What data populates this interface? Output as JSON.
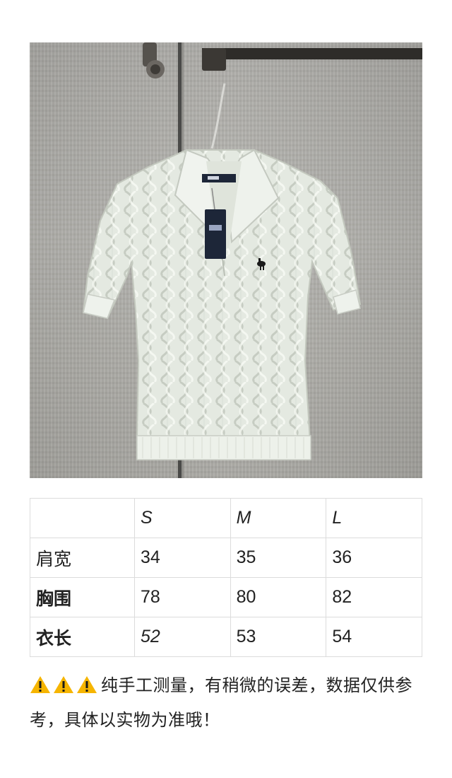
{
  "photo": {
    "icon": "cable-knit-polo-shirt-photo",
    "colors": {
      "wall": "#aeada8",
      "shirt": "#e6ebe3",
      "shirt_shadow": "#c9cec4",
      "tag": "#1d2638"
    }
  },
  "size_table": {
    "headers": [
      "",
      "S",
      "M",
      "L"
    ],
    "rows": [
      {
        "label": "肩宽",
        "values": [
          "34",
          "35",
          "36"
        ]
      },
      {
        "label": "胸围",
        "values": [
          "78",
          "80",
          "82"
        ]
      },
      {
        "label": "衣长",
        "values": [
          "52",
          "53",
          "54"
        ]
      }
    ]
  },
  "note": {
    "icon": "warning-icon",
    "icon_count": 3,
    "icon_color": "#f6b500",
    "text": "纯手工测量，有稍微的误差，数据仅供参考，具体以实物为准哦！"
  }
}
